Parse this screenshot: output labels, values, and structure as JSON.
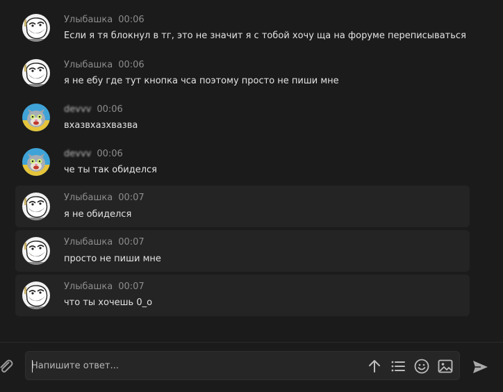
{
  "messages": [
    {
      "author": "Улыбашка",
      "time": "00:06",
      "text": "Если я тя блокнул в тг, это не значит я с тобой хочу ща на форуме переписываться",
      "avatar": "troll-face-avatar"
    },
    {
      "author": "Улыбашка",
      "time": "00:06",
      "text": "я не ебу где тут кнопка чса поэтому просто не пиши мне",
      "avatar": "troll-face-avatar"
    },
    {
      "author": "devvv",
      "time": "00:06",
      "text": "вхазвхазхвазва",
      "avatar": "talking-tom-avatar"
    },
    {
      "author": "devvv",
      "time": "00:06",
      "text": "че ты так обиделся",
      "avatar": "talking-tom-avatar"
    },
    {
      "author": "Улыбашка",
      "time": "00:07",
      "text": "я не обиделся",
      "avatar": "troll-face-avatar"
    },
    {
      "author": "Улыбашка",
      "time": "00:07",
      "text": "просто не пиши мне",
      "avatar": "troll-face-avatar"
    },
    {
      "author": "Улыбашка",
      "time": "00:07",
      "text": "что ты хочешь 0_о",
      "avatar": "troll-face-avatar"
    }
  ],
  "composer": {
    "placeholder": "Напишите ответ...",
    "icons": [
      "paperclip-icon",
      "arrow-up-icon",
      "list-icon",
      "emoji-icon",
      "image-icon",
      "send-icon"
    ]
  },
  "colors": {
    "background": "#1b1b1b",
    "highlight": "#242424",
    "author": "#8d8d8d",
    "text": "#e3e3e3"
  }
}
